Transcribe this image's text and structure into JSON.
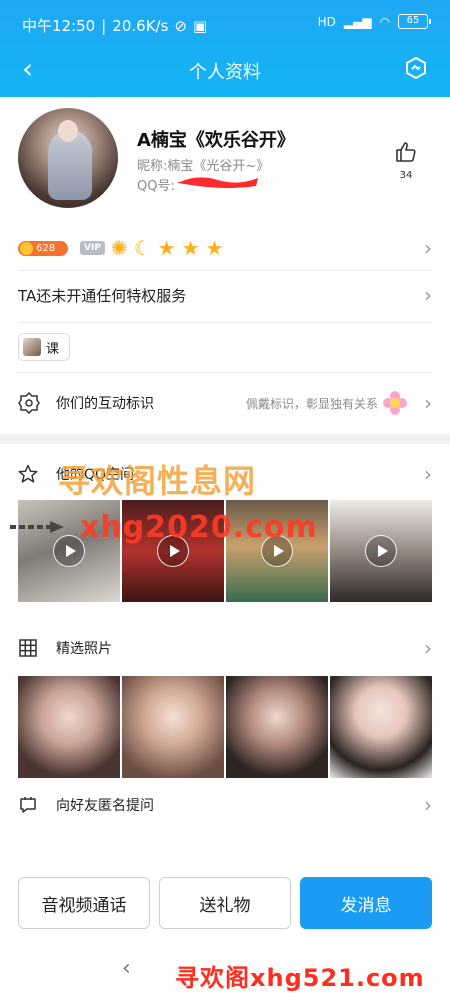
{
  "status_bar": {
    "time": "中午12:50",
    "speed": "20.6K/s",
    "network": "HD",
    "battery": "65"
  },
  "header": {
    "title": "个人资料"
  },
  "profile": {
    "name": "A楠宝《欢乐谷开》",
    "nickname": "昵称:楠宝《光谷开~》",
    "qq_label": "QQ号:",
    "likes": "34"
  },
  "badges": {
    "coin_value": "628",
    "vip_label": "VIP"
  },
  "privilege_text": "TA还未开通任何特权服务",
  "course_label": "课",
  "interaction": {
    "label": "你们的互动标识",
    "hint": "佩戴标识，彰显独有关系"
  },
  "qzone": {
    "label": "他的QQ空间"
  },
  "featured_photos": {
    "label": "精选照片"
  },
  "anonymous_question": {
    "label": "向好友匿名提问"
  },
  "watermarks": {
    "overlay_1": "寻欢阁性息网",
    "overlay_2": "xhg2020.com",
    "bottom": "寻欢阁xhg521.com"
  },
  "actions": {
    "av_call": "音视频通话",
    "gift": "送礼物",
    "message": "发消息"
  },
  "colors": {
    "header_blue": "#1fa8f5",
    "primary_button": "#1a9cf5",
    "watermark_orange": "#f4a23a",
    "watermark_red": "#ff2d20"
  }
}
